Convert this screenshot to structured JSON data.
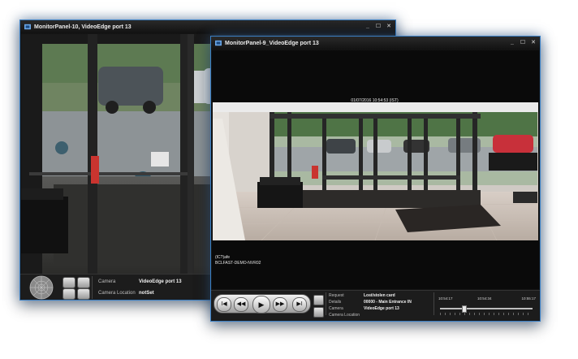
{
  "window_back": {
    "title": "MonitorPanel-10, VideoEdge port 13",
    "window_buttons": [
      "_",
      "☐",
      "✕"
    ],
    "details": {
      "camera_label": "Camera",
      "camera_value": "VideoEdge port 13",
      "location_label": "Camera Location",
      "location_value": "notSet"
    }
  },
  "window_front": {
    "title": "MonitorPanel-9_VideoEdge port 13",
    "window_buttons": [
      "_",
      "☐",
      "✕"
    ],
    "timestamp": "01/07/2016 10:54:53 (IST)",
    "overlay_line1": "(IC?)afe",
    "overlay_line2": "BCLFAST-DEMO-NVR02",
    "playback": {
      "skip_back": "I◀",
      "rewind": "◀◀",
      "play": "▶",
      "forward": "▶▶",
      "skip_forward": "▶I"
    },
    "details": {
      "request_label": "Request",
      "request_value": "Lost/stolen card",
      "details_label": "Details",
      "details_value": "00000 - Main Entrance IN",
      "camera_label": "Camera",
      "camera_value": "VideoEdge port 13",
      "location_label": "Camera Location",
      "location_value": ""
    },
    "timeline": {
      "start": "10:54:17",
      "mid": "10:54:34",
      "end": "10:55:17",
      "position": 0.25
    }
  },
  "colors": {
    "window_border": "#3a7fc4",
    "background": "#141414",
    "controls_bg": "#1c1c1c"
  }
}
